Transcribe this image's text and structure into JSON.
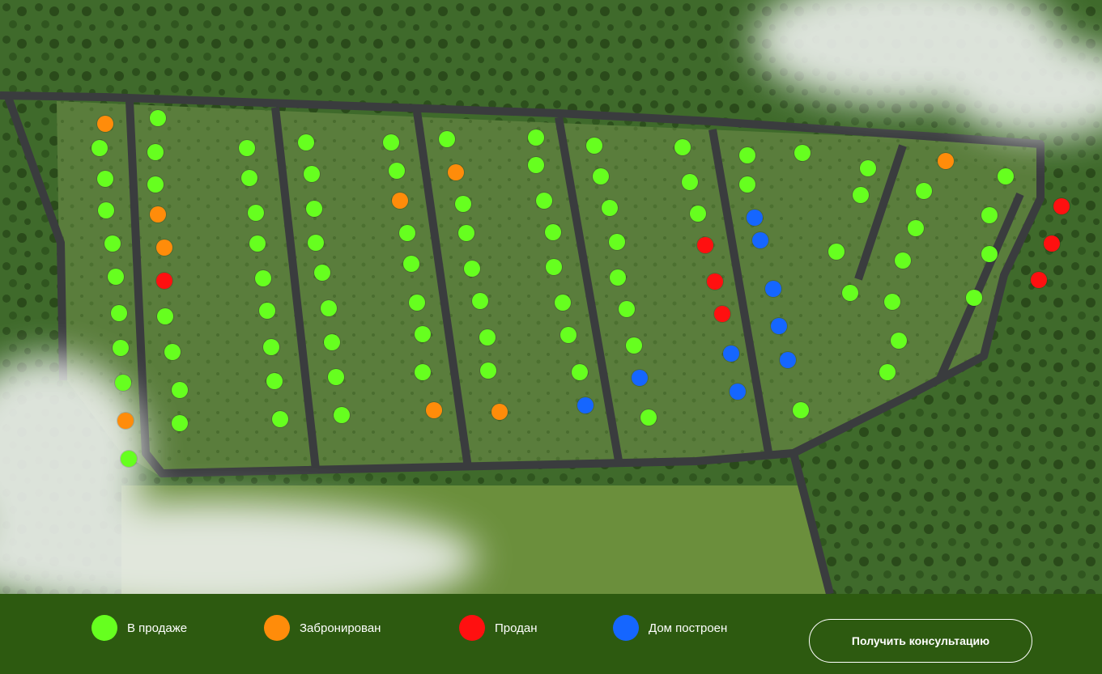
{
  "legend": [
    {
      "key": "sale",
      "label": "В продаже",
      "color": "#66ff1f"
    },
    {
      "key": "booked",
      "label": "Забронирован",
      "color": "#ff8c0a"
    },
    {
      "key": "sold",
      "label": "Продан",
      "color": "#ff1010"
    },
    {
      "key": "built",
      "label": "Дом построен",
      "color": "#1566ff"
    }
  ],
  "cta": {
    "label": "Получить консультацию"
  },
  "colors": {
    "bar": "#2d5a10",
    "map": "#4f7434",
    "road": "#3a3c3e"
  }
}
